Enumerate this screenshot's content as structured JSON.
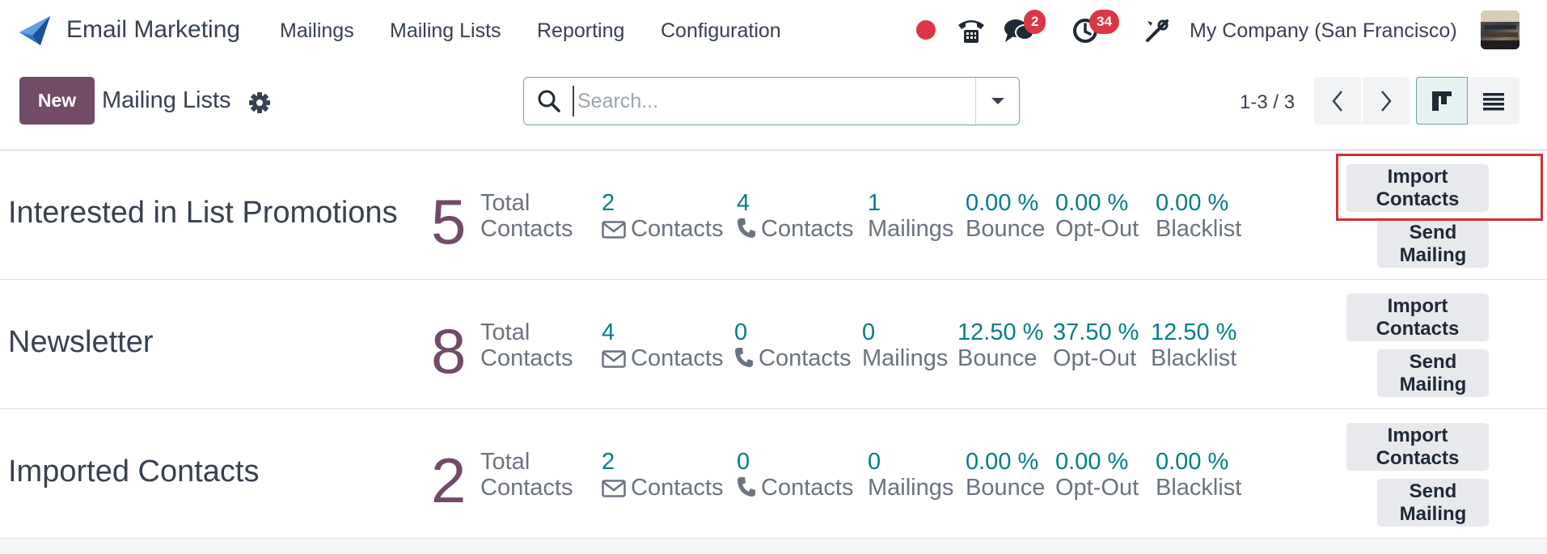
{
  "navbar": {
    "app_title": "Email Marketing",
    "menu": [
      "Mailings",
      "Mailing Lists",
      "Reporting",
      "Configuration"
    ],
    "messages_badge": "2",
    "activities_badge": "34",
    "company": "My Company (San Francisco)"
  },
  "control_panel": {
    "new_label": "New",
    "breadcrumb": "Mailing Lists",
    "search_placeholder": "Search...",
    "pager": "1-3 / 3"
  },
  "records": [
    {
      "name": "Interested in List Promotions",
      "total": "5",
      "total_label_1": "Total",
      "total_label_2": "Contacts",
      "email_contacts": "2",
      "phone_contacts": "4",
      "mailings": "1",
      "bounce": "0.00 %",
      "opt_out": "0.00 %",
      "blacklist": "0.00 %"
    },
    {
      "name": "Newsletter",
      "total": "8",
      "total_label_1": "Total",
      "total_label_2": "Contacts",
      "email_contacts": "4",
      "phone_contacts": "0",
      "mailings": "0",
      "bounce": "12.50 %",
      "opt_out": "37.50 %",
      "blacklist": "12.50 %"
    },
    {
      "name": "Imported Contacts",
      "total": "2",
      "total_label_1": "Total",
      "total_label_2": "Contacts",
      "email_contacts": "2",
      "phone_contacts": "0",
      "mailings": "0",
      "bounce": "0.00 %",
      "opt_out": "0.00 %",
      "blacklist": "0.00 %"
    }
  ],
  "labels": {
    "contacts": "Contacts",
    "mailings": "Mailings",
    "bounce": "Bounce",
    "opt_out": "Opt-Out",
    "blacklist": "Blacklist",
    "import_contacts": "Import Contacts",
    "send_mailing": "Send Mailing"
  },
  "colors": {
    "brand": "#714b67",
    "accent": "#017e84",
    "badge": "#dc3545",
    "highlight": "#d32f2f"
  }
}
